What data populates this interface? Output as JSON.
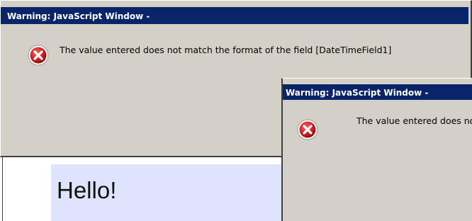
{
  "dialogs": [
    {
      "title": "Warning: JavaScript Window -",
      "message": "The value entered does not match the format of the field [DateTimeField1]",
      "icon": "error-icon"
    },
    {
      "title": "Warning: JavaScript Window -",
      "message": "The value entered does not",
      "icon": "error-icon"
    }
  ],
  "page": {
    "greeting": "Hello!"
  },
  "colors": {
    "titlebar": "#0a246a",
    "dialog_bg": "#d4d0c8",
    "hello_bg": "#dde4fb",
    "error_red": "#cc1f1f"
  }
}
